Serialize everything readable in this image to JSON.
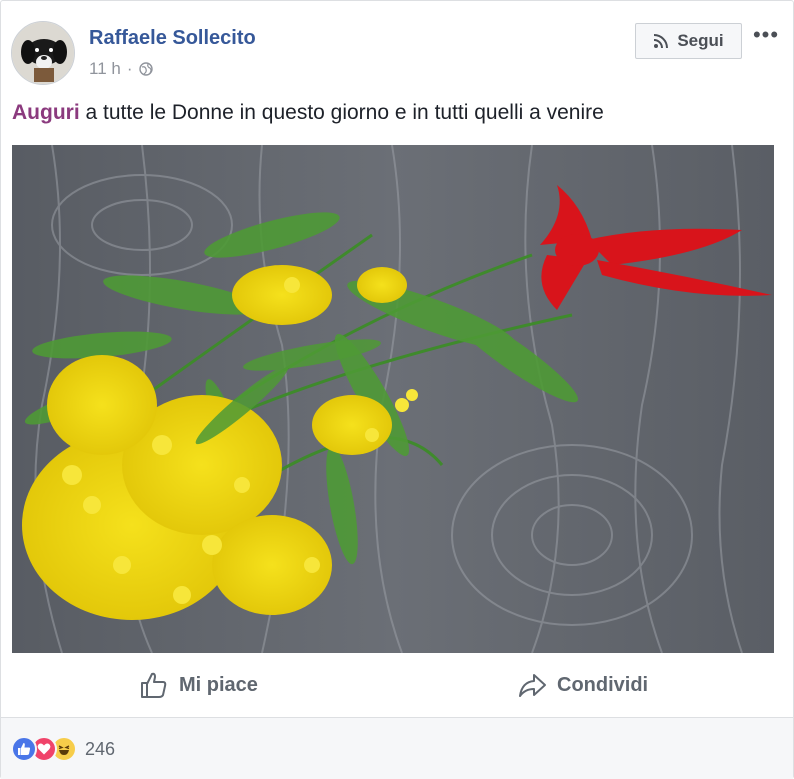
{
  "post": {
    "author": "Raffaele Sollecito",
    "time": "11 h",
    "separator": "·",
    "follow_label": "Segui",
    "more_label": "•••",
    "text_tag": "Auguri",
    "text_rest": " a tutte le Donne in questo giorno e in tutti quelli a venire"
  },
  "actions": {
    "like_label": "Mi piace",
    "share_label": "Condividi"
  },
  "reactions": {
    "count": "246",
    "types": [
      "like-icon",
      "love-icon",
      "haha-icon"
    ]
  },
  "icons": {
    "follow": "rss-icon",
    "privacy": "globe-icon",
    "like": "thumbs-up-icon",
    "share": "share-arrow-icon"
  },
  "colors": {
    "link": "#365899",
    "tag": "#8b3a7e",
    "like_blue": "#4a76e8",
    "love_red": "#f0436a",
    "haha_yellow": "#f7cd4a"
  }
}
